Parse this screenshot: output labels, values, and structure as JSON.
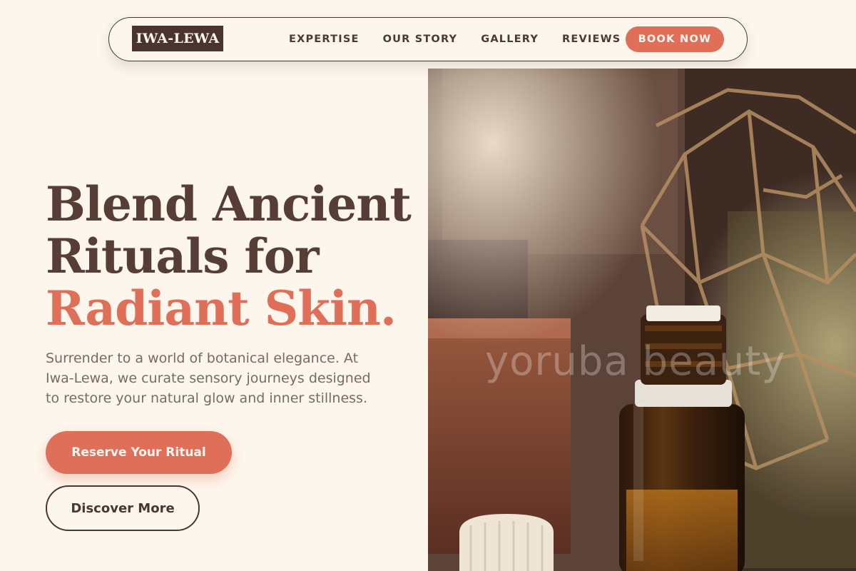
{
  "nav": {
    "logo": "IWA-LEWA",
    "links": [
      "EXPERTISE",
      "OUR STORY",
      "GALLERY",
      "REVIEWS"
    ],
    "cta": "BOOK NOW"
  },
  "hero": {
    "title_line1": "Blend Ancient",
    "title_line2": "Rituals for",
    "title_accent": "Radiant Skin.",
    "description": "Surrender to a world of botanical elegance. At Iwa-Lewa, we curate sensory journeys designed to restore your natural glow and inner stillness.",
    "primary_button": "Reserve Your Ritual",
    "secondary_button": "Discover More"
  },
  "image": {
    "watermark": "yoruba beauty",
    "subject": "amber dropper bottle with botanical background"
  },
  "colors": {
    "background": "#fdf6ec",
    "accent": "#df6f58",
    "dark": "#4a342e",
    "text": "#563d36"
  }
}
